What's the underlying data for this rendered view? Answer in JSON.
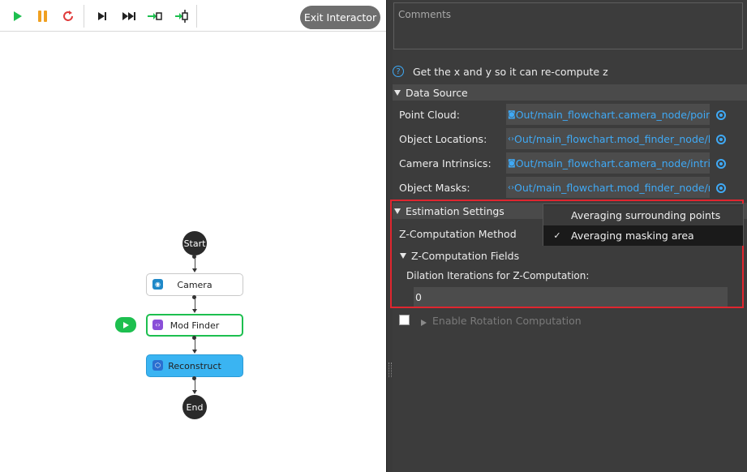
{
  "toolbar": {
    "exit_label": "Exit Interactor"
  },
  "flowchart": {
    "start_label": "Start",
    "end_label": "End",
    "nodes": [
      {
        "label": "Camera"
      },
      {
        "label": "Mod Finder"
      },
      {
        "label": "Reconstruct"
      }
    ]
  },
  "panel": {
    "comments_placeholder": "Comments",
    "help_text": "Get the x and y so it can re-compute z",
    "data_source": {
      "title": "Data Source",
      "rows": [
        {
          "label": "Point Cloud:",
          "value": "Out/main_flowchart.camera_node/pointCloud"
        },
        {
          "label": "Object Locations:",
          "value": "Out/main_flowchart.mod_finder_node/labels"
        },
        {
          "label": "Camera Intrinsics:",
          "value": "Out/main_flowchart.camera_node/intrinsics"
        },
        {
          "label": "Object Masks:",
          "value": "Out/main_flowchart.mod_finder_node/masks"
        }
      ]
    },
    "estimation": {
      "title": "Estimation Settings",
      "method_label": "Z-Computation Method",
      "fields_title": "Z-Computation Fields",
      "dilation_label": "Dilation Iterations for Z-Computation:",
      "dilation_value": "0",
      "rotation_label": "Enable Rotation Computation"
    },
    "dropdown": {
      "options": [
        {
          "label": "Averaging surrounding points",
          "checked": false
        },
        {
          "label": "Averaging masking area",
          "checked": true
        }
      ],
      "check_mark": "✓"
    }
  },
  "colors": {
    "accent_blue": "#3fa9f5",
    "highlight_red": "#e0262f",
    "run_green": "#1dbf4f",
    "pause_orange": "#f0a020",
    "stop_red": "#e03c3c"
  }
}
